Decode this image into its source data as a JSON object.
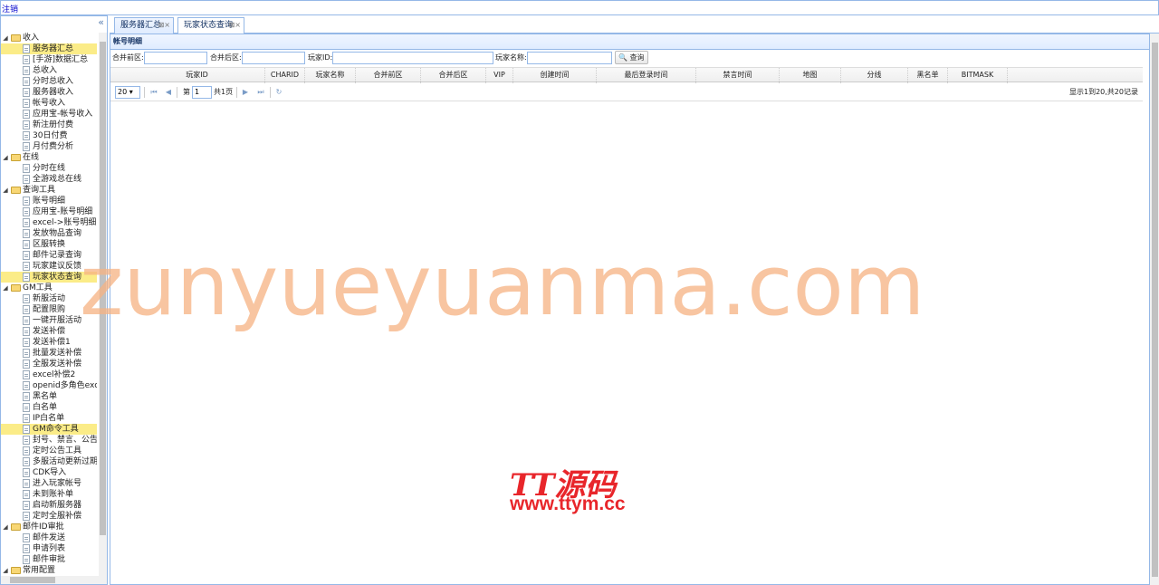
{
  "top": {
    "logout": "注销"
  },
  "left": {
    "collapse": "«",
    "tree": [
      {
        "type": "folder",
        "label": "收入",
        "expanded": true,
        "selected": false
      },
      {
        "type": "file",
        "label": "服务器汇总",
        "selected": true
      },
      {
        "type": "file",
        "label": "[手游]数据汇总",
        "selected": false
      },
      {
        "type": "file",
        "label": "总收入",
        "selected": false
      },
      {
        "type": "file",
        "label": "分时总收入",
        "selected": false
      },
      {
        "type": "file",
        "label": "服务器收入",
        "selected": false
      },
      {
        "type": "file",
        "label": "帐号收入",
        "selected": false
      },
      {
        "type": "file",
        "label": "应用宝-帐号收入",
        "selected": false
      },
      {
        "type": "file",
        "label": "新注册付费",
        "selected": false
      },
      {
        "type": "file",
        "label": "30日付费",
        "selected": false
      },
      {
        "type": "file",
        "label": "月付费分析",
        "selected": false
      },
      {
        "type": "folder",
        "label": "在线",
        "expanded": true,
        "selected": false
      },
      {
        "type": "file",
        "label": "分时在线",
        "selected": false
      },
      {
        "type": "file",
        "label": "全游戏总在线",
        "selected": false
      },
      {
        "type": "folder",
        "label": "查询工具",
        "expanded": true,
        "selected": false
      },
      {
        "type": "file",
        "label": "账号明细",
        "selected": false
      },
      {
        "type": "file",
        "label": "应用宝-账号明细",
        "selected": false
      },
      {
        "type": "file",
        "label": "excel->账号明细",
        "selected": false
      },
      {
        "type": "file",
        "label": "发放物品查询",
        "selected": false
      },
      {
        "type": "file",
        "label": "区服转换",
        "selected": false
      },
      {
        "type": "file",
        "label": "邮件记录查询",
        "selected": false
      },
      {
        "type": "file",
        "label": "玩家建议反馈",
        "selected": false
      },
      {
        "type": "file",
        "label": "玩家状态查询",
        "selected": true
      },
      {
        "type": "folder",
        "label": "GM工具",
        "expanded": true,
        "selected": false
      },
      {
        "type": "file",
        "label": "新服活动",
        "selected": false
      },
      {
        "type": "file",
        "label": "配置限购",
        "selected": false
      },
      {
        "type": "file",
        "label": "一键开服活动",
        "selected": false
      },
      {
        "type": "file",
        "label": "发送补偿",
        "selected": false
      },
      {
        "type": "file",
        "label": "发送补偿1",
        "selected": false
      },
      {
        "type": "file",
        "label": "批量发送补偿",
        "selected": false
      },
      {
        "type": "file",
        "label": "全服发送补偿",
        "selected": false
      },
      {
        "type": "file",
        "label": "excel补偿2",
        "selected": false
      },
      {
        "type": "file",
        "label": "openid多角色excel",
        "selected": false
      },
      {
        "type": "file",
        "label": "黑名单",
        "selected": false
      },
      {
        "type": "file",
        "label": "白名单",
        "selected": false
      },
      {
        "type": "file",
        "label": "IP白名单",
        "selected": false
      },
      {
        "type": "file",
        "label": "GM命令工具",
        "selected": true
      },
      {
        "type": "file",
        "label": "封号、禁言、公告",
        "selected": false
      },
      {
        "type": "file",
        "label": "定时公告工具",
        "selected": false
      },
      {
        "type": "file",
        "label": "多服活动更新过期",
        "selected": false
      },
      {
        "type": "file",
        "label": "CDK导入",
        "selected": false
      },
      {
        "type": "file",
        "label": "进入玩家帐号",
        "selected": false
      },
      {
        "type": "file",
        "label": "未到账补单",
        "selected": false
      },
      {
        "type": "file",
        "label": "启动新服务器",
        "selected": false
      },
      {
        "type": "file",
        "label": "定时全服补偿",
        "selected": false
      },
      {
        "type": "folder",
        "label": "邮件ID审批",
        "expanded": true,
        "selected": false
      },
      {
        "type": "file",
        "label": "邮件发送",
        "selected": false
      },
      {
        "type": "file",
        "label": "申请列表",
        "selected": false
      },
      {
        "type": "file",
        "label": "邮件审批",
        "selected": false
      },
      {
        "type": "folder",
        "label": "常用配置",
        "expanded": true,
        "selected": false
      }
    ]
  },
  "tabs": [
    {
      "label": "服务器汇总",
      "close": "⊠×",
      "active": false
    },
    {
      "label": "玩家状态查询",
      "close": "⊠×",
      "active": true
    }
  ],
  "panel": {
    "title": "帐号明细",
    "search": {
      "merge_before_label": "合并前区:",
      "merge_after_label": "合并后区:",
      "player_id_label": "玩家ID:",
      "player_name_label": "玩家名称:",
      "query_button": "查询"
    },
    "columns": [
      "玩家ID",
      "CHARID",
      "玩家名称",
      "合并前区",
      "合并后区",
      "VIP",
      "创建时间",
      "最后登录时间",
      "禁言时间",
      "地图",
      "分线",
      "黑名单",
      "BITMASK"
    ],
    "pager": {
      "page_size": "20",
      "page_label_pre": "第",
      "page_value": "1",
      "page_label_post": "共1页",
      "info": "显示1到20,共20记录"
    }
  },
  "watermark": {
    "big": "zunyueyuanma.com",
    "logo": "TT源码",
    "url": "www.ttym.cc"
  },
  "colors": {
    "accent_border": "#95b8e7",
    "selected_bg": "#fbec88",
    "watermark_red": "#e8262b",
    "watermark_orange": "#f6b282"
  }
}
